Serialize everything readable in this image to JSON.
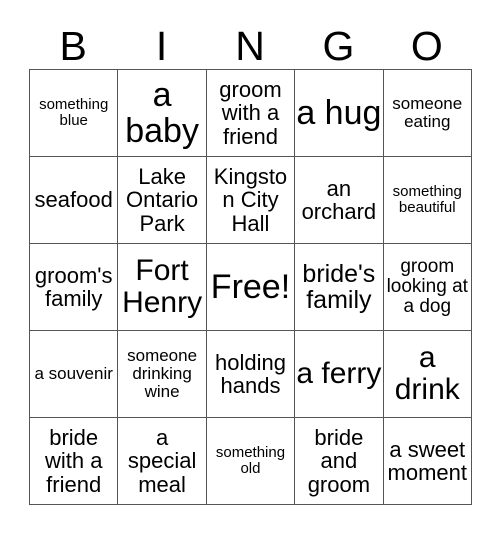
{
  "card": {
    "header_letters": [
      "B",
      "I",
      "N",
      "G",
      "O"
    ],
    "rows": [
      [
        {
          "text": "something blue",
          "size": "fs-xs"
        },
        {
          "text": "a baby",
          "size": "fs-xxl"
        },
        {
          "text": "groom with a friend",
          "size": "fs-md"
        },
        {
          "text": "a hug",
          "size": "fs-xxl"
        },
        {
          "text": "someone eating",
          "size": "fs-sm"
        }
      ],
      [
        {
          "text": "seafood",
          "size": "fs-md"
        },
        {
          "text": "Lake Ontario Park",
          "size": "fs-md"
        },
        {
          "text": "Kingston City Hall",
          "size": "fs-md"
        },
        {
          "text": "an orchard",
          "size": "fs-md"
        },
        {
          "text": "something beautiful",
          "size": "fs-xs"
        }
      ],
      [
        {
          "text": "groom's family",
          "size": "fs-md"
        },
        {
          "text": "Fort Henry",
          "size": "fs-xl"
        },
        {
          "text": "Free!",
          "size": "fs-free"
        },
        {
          "text": "bride's family",
          "size": "fs-lg"
        },
        {
          "text": "groom looking at a dog",
          "size": "fs-smd"
        }
      ],
      [
        {
          "text": "a souvenir",
          "size": "fs-sm"
        },
        {
          "text": "someone drinking wine",
          "size": "fs-sm"
        },
        {
          "text": "holding hands",
          "size": "fs-md"
        },
        {
          "text": "a ferry",
          "size": "fs-xl"
        },
        {
          "text": "a drink",
          "size": "fs-xl"
        }
      ],
      [
        {
          "text": "bride with a friend",
          "size": "fs-md"
        },
        {
          "text": "a special meal",
          "size": "fs-md"
        },
        {
          "text": "something old",
          "size": "fs-xs"
        },
        {
          "text": "bride and groom",
          "size": "fs-md"
        },
        {
          "text": "a sweet moment",
          "size": "fs-md"
        }
      ]
    ]
  },
  "colors": {
    "background": "#ffffff",
    "text": "#000000",
    "grid_line": "#555555"
  }
}
